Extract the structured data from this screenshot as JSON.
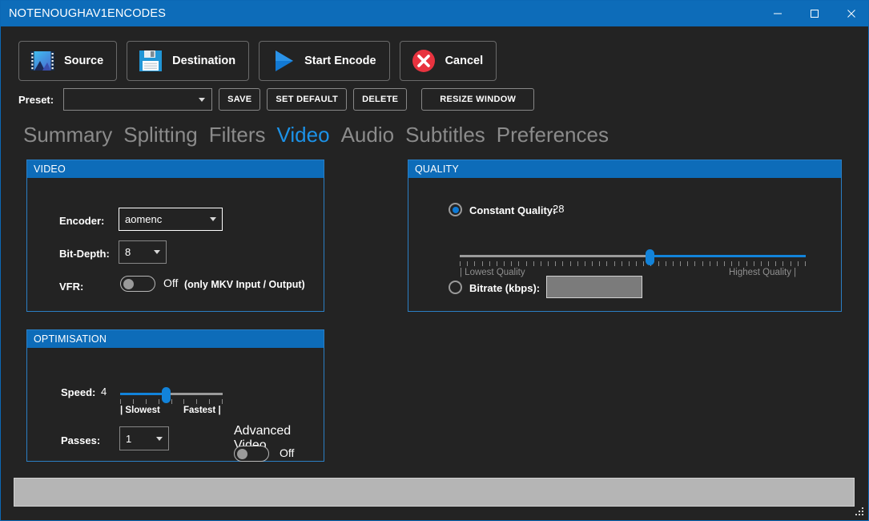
{
  "window": {
    "title": "NOTENOUGHAV1ENCODES",
    "minimize": "minimize-icon",
    "maximize": "maximize-icon",
    "close": "close-icon"
  },
  "toolbar": {
    "buttons": [
      {
        "label": "Source",
        "icon": "film-image-icon"
      },
      {
        "label": "Destination",
        "icon": "floppy-disk-icon"
      },
      {
        "label": "Start Encode",
        "icon": "play-triangle-icon"
      },
      {
        "label": "Cancel",
        "icon": "cancel-circle-icon"
      }
    ]
  },
  "preset": {
    "label": "Preset:",
    "value": "",
    "placeholder": "",
    "save": "SAVE",
    "set_default": "SET DEFAULT",
    "delete": "DELETE",
    "resize_window": "RESIZE WINDOW"
  },
  "tabs": [
    {
      "label": "Summary",
      "active": false
    },
    {
      "label": "Splitting",
      "active": false
    },
    {
      "label": "Filters",
      "active": false
    },
    {
      "label": "Video",
      "active": true
    },
    {
      "label": "Audio",
      "active": false
    },
    {
      "label": "Subtitles",
      "active": false
    },
    {
      "label": "Preferences",
      "active": false
    }
  ],
  "video_group": {
    "header": "VIDEO",
    "encoder_label": "Encoder:",
    "encoder_value": "aomenc",
    "bitdepth_label": "Bit-Depth:",
    "bitdepth_value": "8",
    "vfr_label": "VFR:",
    "vfr_state": "Off",
    "vfr_hint": "(only MKV Input / Output)"
  },
  "quality_group": {
    "header": "QUALITY",
    "constant_quality_label": "Constant Quality:",
    "constant_quality_value": "28",
    "quality_slider": {
      "position_percent": 55,
      "left_scale_label": "| Lowest Quality",
      "right_scale_label": "Highest Quality |"
    },
    "bitrate_label": "Bitrate (kbps):",
    "bitrate_value": ""
  },
  "optimisation_group": {
    "header": "OPTIMISATION",
    "speed_label": "Speed:",
    "speed_value": "4",
    "speed_slider": {
      "position_percent": 45,
      "left_scale_label": "| Slowest",
      "right_scale_label": "Fastest |"
    },
    "passes_label": "Passes:",
    "passes_value": "1",
    "advanced_video_label": "Advanced Video",
    "advanced_video_state": "Off"
  },
  "status": {
    "progress_text": "",
    "resize_grip": "resize-grip-icon"
  },
  "colors": {
    "accent": "#0d6cb9",
    "accent_light": "#1c92e8",
    "background": "#232323",
    "slider_blue": "#1283da",
    "cancel_red": "#e8333f"
  }
}
